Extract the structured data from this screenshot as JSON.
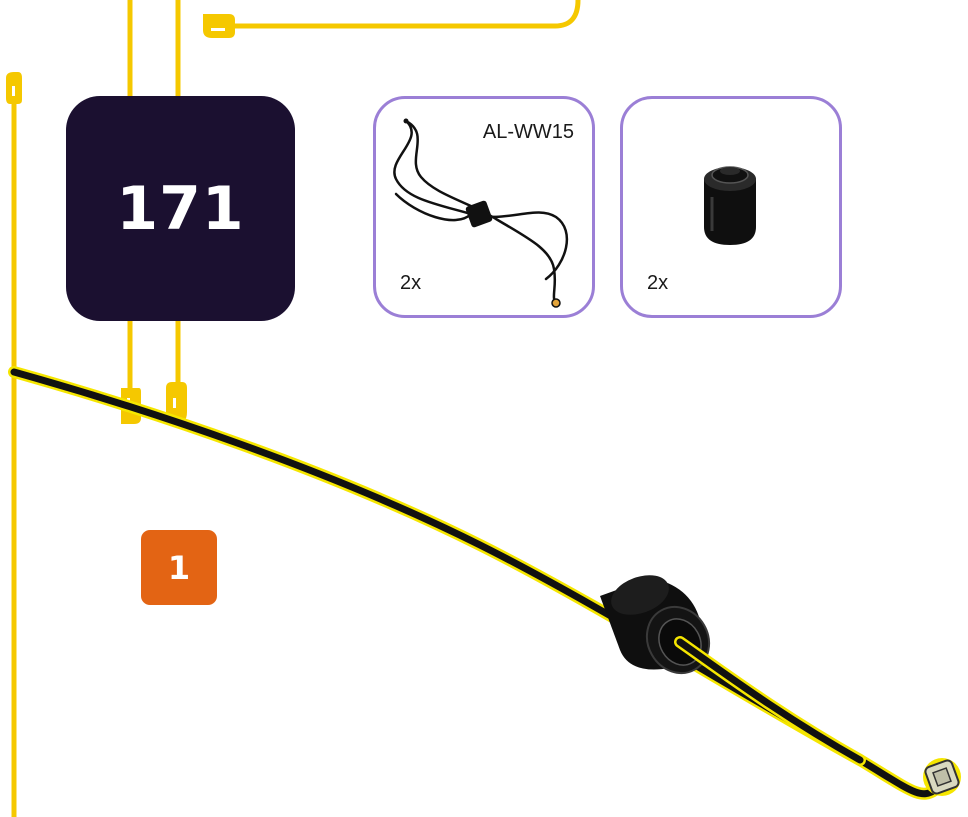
{
  "step": {
    "number": "171"
  },
  "parts": [
    {
      "code": "AL-WW15",
      "qty": "2x",
      "icon": "antenna-wire-icon"
    },
    {
      "code": "",
      "qty": "2x",
      "icon": "black-round-brick-icon"
    }
  ],
  "substep": {
    "number": "1"
  },
  "colors": {
    "step_box": "#1b1030",
    "card_border": "#9b7fd6",
    "substep_badge": "#e36414",
    "guide_line": "#f5c800",
    "wire": "#111111"
  }
}
